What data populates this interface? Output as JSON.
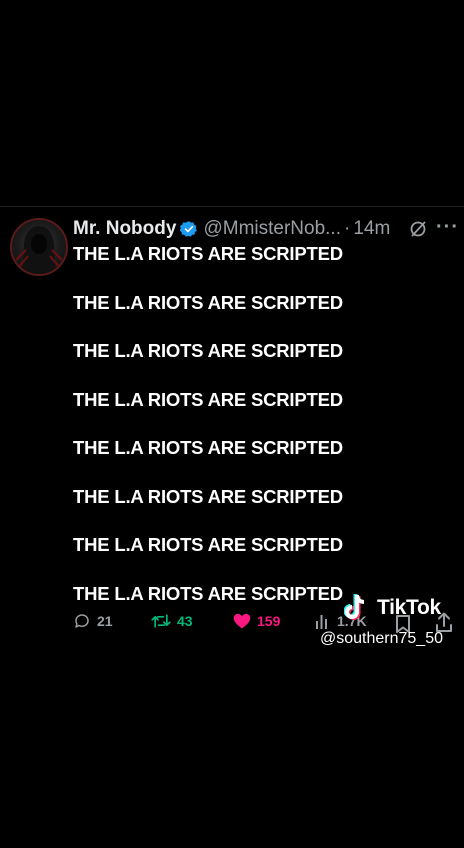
{
  "tweet": {
    "author_name": "Mr. Nobody",
    "handle": "@MmisterNob...",
    "separator": "·",
    "time": "14m",
    "more_label": "···",
    "lines": [
      "THE L.A RIOTS ARE SCRIPTED",
      "THE L.A RIOTS ARE SCRIPTED",
      "THE L.A RIOTS ARE SCRIPTED",
      "THE L.A RIOTS ARE SCRIPTED",
      "THE L.A RIOTS ARE SCRIPTED",
      "THE L.A RIOTS ARE SCRIPTED",
      "THE L.A RIOTS ARE SCRIPTED",
      "THE L.A RIOTS ARE SCRIPTED"
    ],
    "replies": "21",
    "retweets": "43",
    "likes": "159",
    "views": "1.7K"
  },
  "watermark": {
    "brand": "TikTok",
    "username": "@southern75_50"
  },
  "colors": {
    "background": "#000000",
    "verified": "#1d9bf0",
    "retweet": "#00ba7c",
    "like": "#f91880",
    "muted": "#9a9fa4"
  }
}
